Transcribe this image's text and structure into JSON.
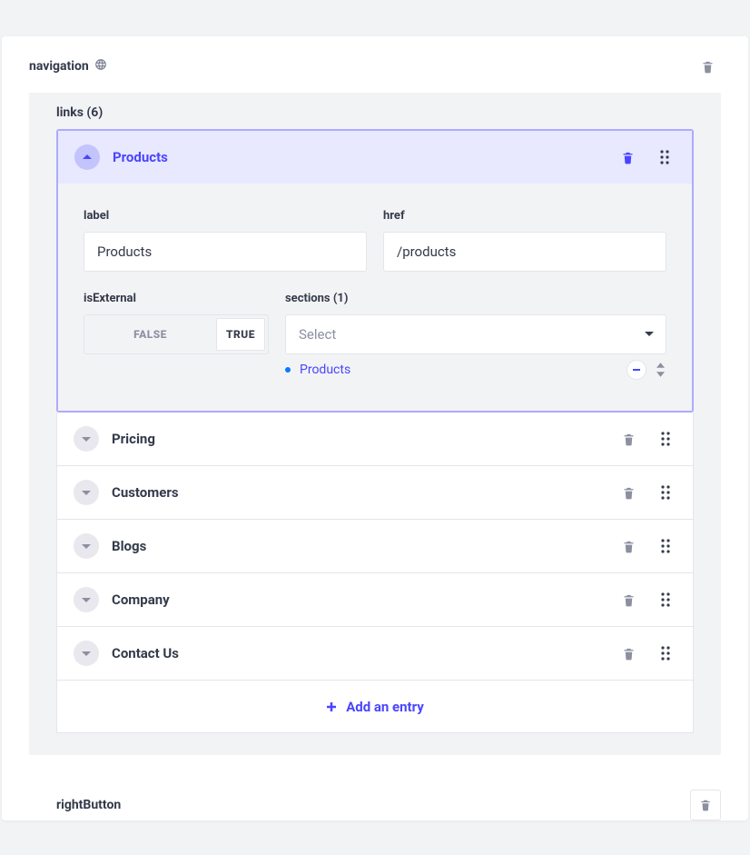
{
  "section": {
    "title": "navigation"
  },
  "links": {
    "title": "links (6)",
    "add_label": "Add an entry",
    "items": [
      {
        "title": "Products",
        "expanded": true
      },
      {
        "title": "Pricing",
        "expanded": false
      },
      {
        "title": "Customers",
        "expanded": false
      },
      {
        "title": "Blogs",
        "expanded": false
      },
      {
        "title": "Company",
        "expanded": false
      },
      {
        "title": "Contact Us",
        "expanded": false
      }
    ]
  },
  "expanded_fields": {
    "label_label": "label",
    "label_value": "Products",
    "href_label": "href",
    "href_value": "/products",
    "isExternal_label": "isExternal",
    "isExternal_false": "FALSE",
    "isExternal_true": "TRUE",
    "sections_label": "sections (1)",
    "sections_placeholder": "Select",
    "section_link_text": "Products"
  },
  "rightButton": {
    "label": "rightButton"
  }
}
